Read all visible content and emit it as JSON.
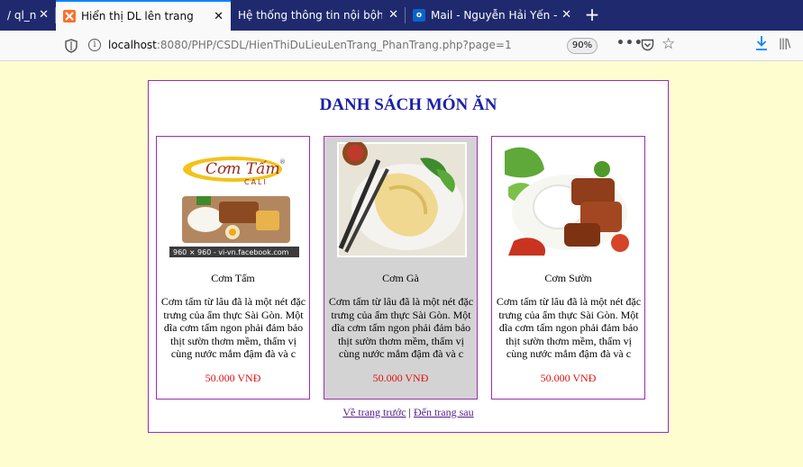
{
  "browser": {
    "tabs": [
      {
        "title": "/ ql_n",
        "active": false
      },
      {
        "title": "Hiển thị DL lên trang",
        "active": true
      },
      {
        "title": "Hệ thống thông tin nội bộhệ thống",
        "active": false
      },
      {
        "title": "Mail - Nguyễn Hải Yến - Outlo",
        "active": false
      }
    ],
    "new_tab_label": "+",
    "close_glyph": "✕",
    "url_host": "localhost",
    "url_rest": ":8080/PHP/CSDL/HienThiDuLieuLenTrang_PhanTrang.php?page=1",
    "zoom": "90%",
    "more_glyph": "•••"
  },
  "page": {
    "heading": "DANH SÁCH MÓN ĂN",
    "dishes": [
      {
        "name": "Cơm Tấm",
        "description": "Cơm tấm từ lâu đã là một nét đặc trưng của ẩm thực Sài Gòn. Một dĩa cơm tấm ngon phải đảm bảo thịt sườn thơm mềm, thấm vị cùng nước mắm đậm đà và c",
        "price": "50.000 VNĐ",
        "logo_text": "Cơm Tấm",
        "logo_sub": "CALI",
        "watermark": "960 × 960 - vi-vn.facebook.com"
      },
      {
        "name": "Cơm Gà",
        "description": "Cơm tấm từ lâu đã là một nét đặc trưng của ẩm thực Sài Gòn. Một dĩa cơm tấm ngon phải đảm bảo thịt sườn thơm mềm, thấm vị cùng nước mắm đậm đà và c",
        "price": "50.000 VNĐ"
      },
      {
        "name": "Cơm Sườn",
        "description": "Cơm tấm từ lâu đã là một nét đặc trưng của ẩm thực Sài Gòn. Một dĩa cơm tấm ngon phải đảm bảo thịt sườn thơm mềm, thấm vị cùng nước mắm đậm đà và c",
        "price": "50.000 VNĐ"
      }
    ],
    "prev_link": "Về trang trước",
    "separator": " | ",
    "next_link": "Đến trang sau"
  },
  "colors": {
    "page_bg": "#fefdd0",
    "border": "#9b2fae",
    "heading": "#1a20a8",
    "price": "#e01010",
    "tab_bar": "#1f2a6e"
  }
}
